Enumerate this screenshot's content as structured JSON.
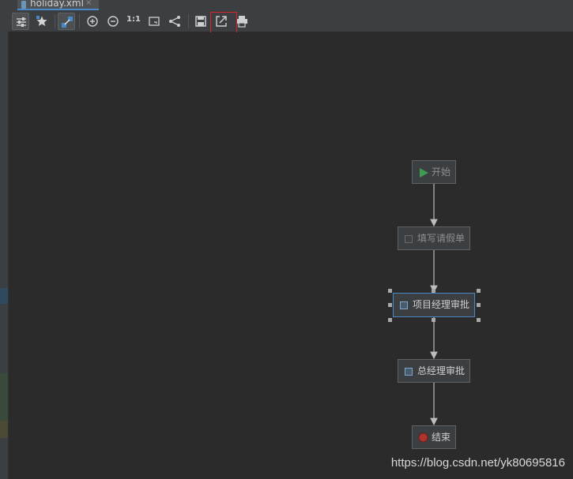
{
  "tab": {
    "filename": "holiday.xml",
    "close_glyph": "×"
  },
  "toolbar": {
    "buttons": [
      {
        "name": "settings-icon",
        "active": true
      },
      {
        "name": "star-icon",
        "active": false
      },
      {
        "name": "connect-icon",
        "active": true
      },
      {
        "name": "zoom-in-icon",
        "active": false
      },
      {
        "name": "zoom-out-icon",
        "active": false
      },
      {
        "name": "actual-size",
        "text": "1:1"
      },
      {
        "name": "fit-content-icon",
        "active": false
      },
      {
        "name": "layout-icon",
        "active": false
      },
      {
        "name": "save-icon",
        "active": false
      },
      {
        "name": "export-image-icon",
        "active": false,
        "highlighted": true
      },
      {
        "name": "print-icon",
        "active": false
      }
    ],
    "actual_size_label": "1:1"
  },
  "diagram": {
    "nodes": [
      {
        "id": "start",
        "label": "开始",
        "type": "start-event"
      },
      {
        "id": "fill",
        "label": "填写请假单",
        "type": "user-task"
      },
      {
        "id": "pm",
        "label": "项目经理审批",
        "type": "user-task",
        "selected": true
      },
      {
        "id": "gm",
        "label": "总经理审批",
        "type": "user-task"
      },
      {
        "id": "end",
        "label": "结束",
        "type": "end-event"
      }
    ]
  },
  "watermark": "https://blog.csdn.net/yk80695816",
  "colors": {
    "accent": "#4a88c7",
    "highlight": "#d8262b",
    "start_green": "#3f9b4f",
    "end_red": "#b0342e"
  }
}
